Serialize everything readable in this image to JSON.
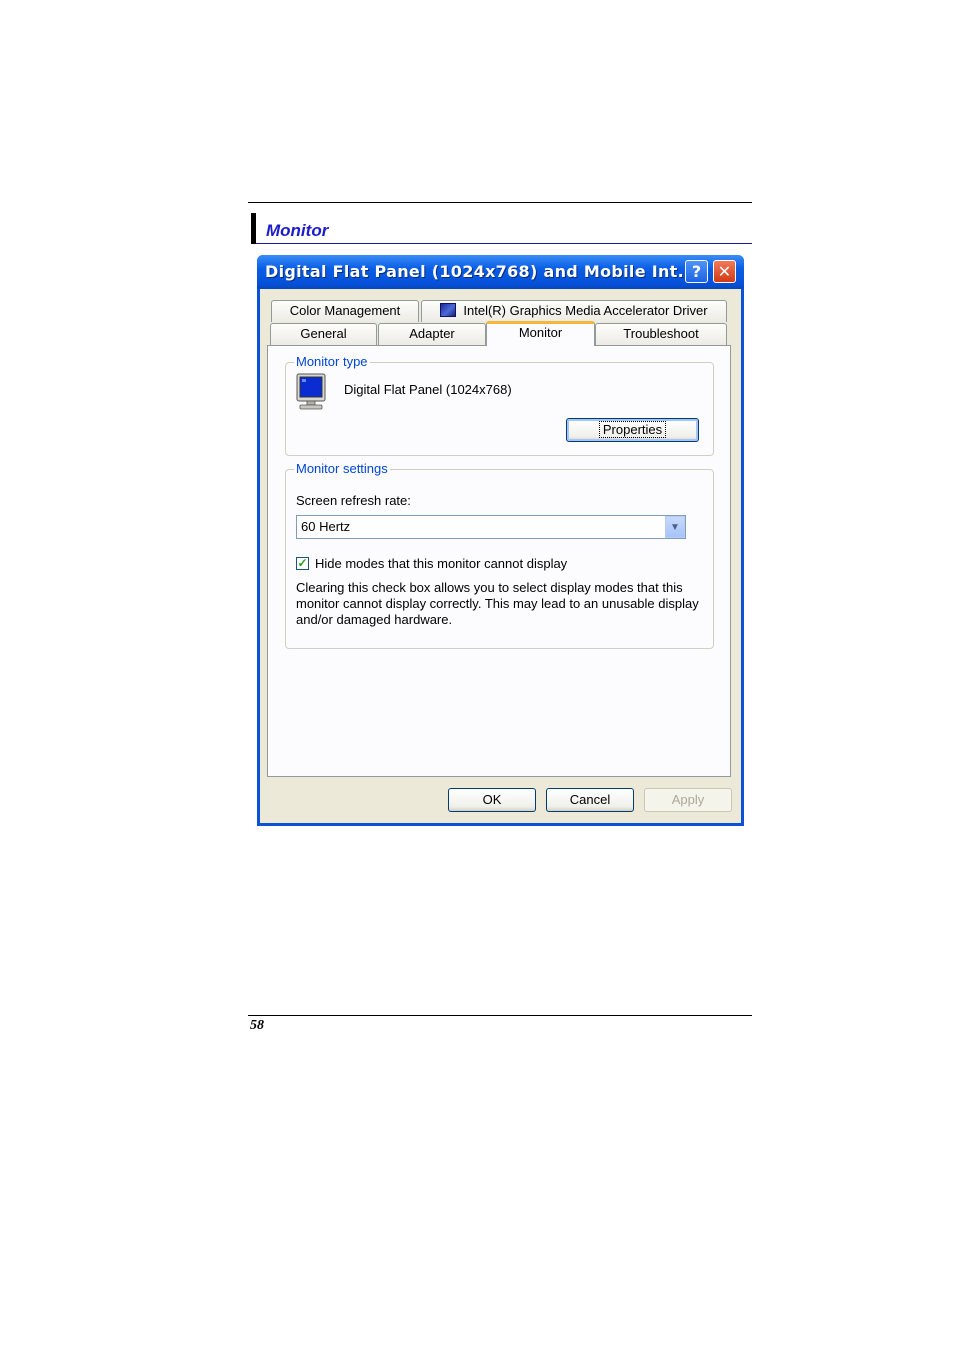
{
  "section": {
    "title": "Monitor"
  },
  "page": {
    "number": "58"
  },
  "window": {
    "title": "Digital Flat Panel (1024x768) and Mobile Int...",
    "help_glyph": "?",
    "close_glyph": "✕"
  },
  "tabs": {
    "row1": [
      {
        "label": "Color Management"
      },
      {
        "label": "Intel(R) Graphics Media Accelerator Driver",
        "icon": "intel-graphics-icon"
      }
    ],
    "row2": [
      {
        "label": "General"
      },
      {
        "label": "Adapter"
      },
      {
        "label": "Monitor",
        "active": true
      },
      {
        "label": "Troubleshoot"
      }
    ]
  },
  "monitor_type": {
    "group_label": "Monitor type",
    "name": "Digital Flat Panel (1024x768)",
    "properties_button": "Properties"
  },
  "monitor_settings": {
    "group_label": "Monitor settings",
    "refresh_label": "Screen refresh rate:",
    "refresh_value": "60 Hertz",
    "hide_modes_label": "Hide modes that this monitor cannot display",
    "hide_modes_checked": true,
    "description": "Clearing this check box allows you to select display modes that this monitor cannot display correctly. This may lead to an unusable display and/or damaged hardware."
  },
  "buttons": {
    "ok": "OK",
    "cancel": "Cancel",
    "apply": "Apply"
  },
  "colors": {
    "titlebar": "#0a5ee6",
    "group_label": "#0046d5",
    "section_title": "#1c1ccc",
    "active_tab_highlight": "#f6b53a"
  }
}
